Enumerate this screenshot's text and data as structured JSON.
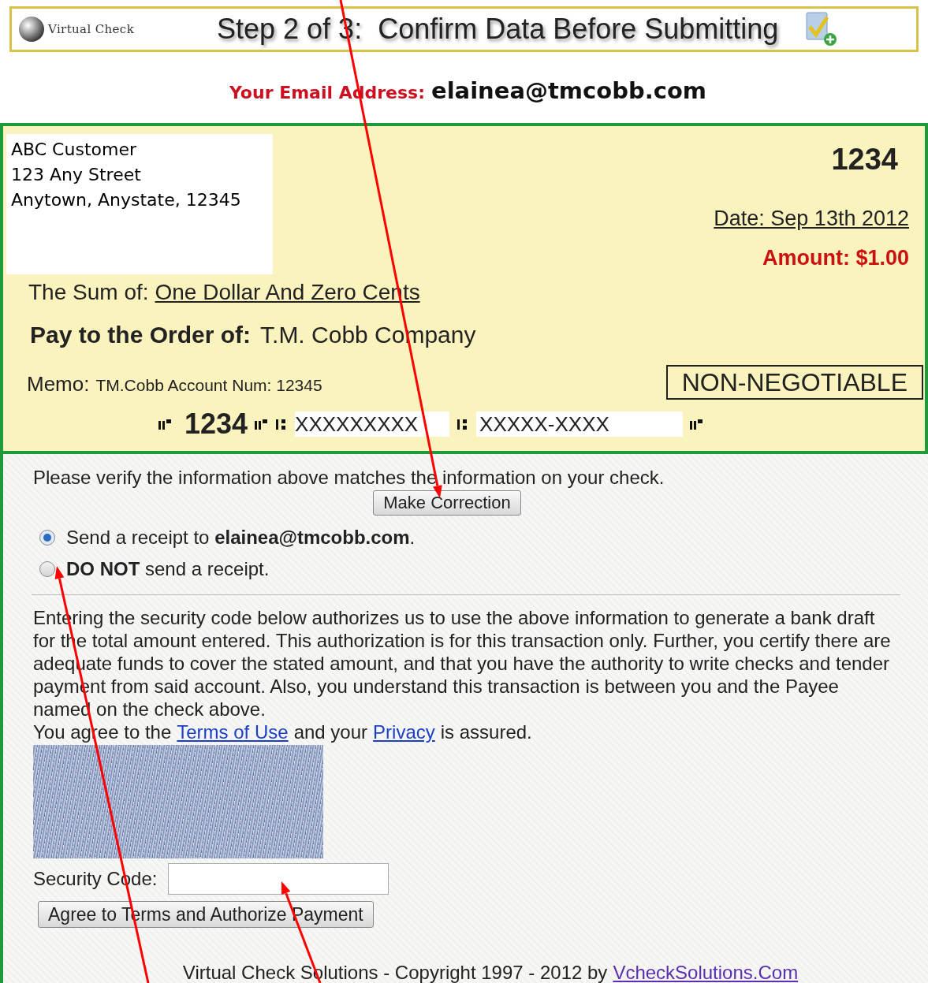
{
  "header": {
    "logo_text": "Virtual Check",
    "title": "Step 2 of 3:  Confirm Data Before Submitting"
  },
  "email": {
    "label": "Your Email Address:",
    "value": "elainea@tmcobb.com"
  },
  "check": {
    "address_lines": [
      "ABC Customer",
      "123 Any Street",
      "Anytown, Anystate, 12345"
    ],
    "number": "1234",
    "date": "Date: Sep 13th 2012",
    "amount": "Amount: $1.00",
    "sum_label": "The Sum of:",
    "sum_value": "One Dollar And Zero Cents",
    "payee_label": "Pay to the Order of:",
    "payee_value": "T.M. Cobb Company",
    "memo_label": "Memo:",
    "memo_value": "TM.Cobb Account Num: 12345",
    "stamp": "NON-NEGOTIABLE",
    "micr": {
      "check_number": "1234",
      "routing": "XXXXXXXXX",
      "account": "XXXXX-XXXX"
    }
  },
  "verify_text": "Please verify the information above matches the information on your check.",
  "correction_button": "Make Correction",
  "receipt_options": [
    {
      "label": "Send a receipt to **elainea@tmcobb.com**.",
      "selected": true
    },
    {
      "label": "**DO NOT** send a receipt.",
      "selected": false
    }
  ],
  "authorization_text": "Entering the security code below authorizes us to use the above information to generate a bank draft for the total amount entered. This authorization is for this transaction only. Further, you certify there are adequate funds to cover the stated amount, and that you have the authority to write checks and tender payment from said account. Also, you understand this transaction is between you and the Payee named on the check above.",
  "agreement": {
    "before": "You agree to the",
    "terms_link": "Terms of Use",
    "middle": "and your",
    "privacy_link": "Privacy",
    "after": "is assured."
  },
  "security_code": {
    "label": "Security Code:"
  },
  "submit_button": "Agree to Terms and Authorize Payment",
  "footer": {
    "text": "Virtual Check Solutions - Copyright 1997 - 2012 by",
    "link": "VcheckSolutions.Com"
  }
}
